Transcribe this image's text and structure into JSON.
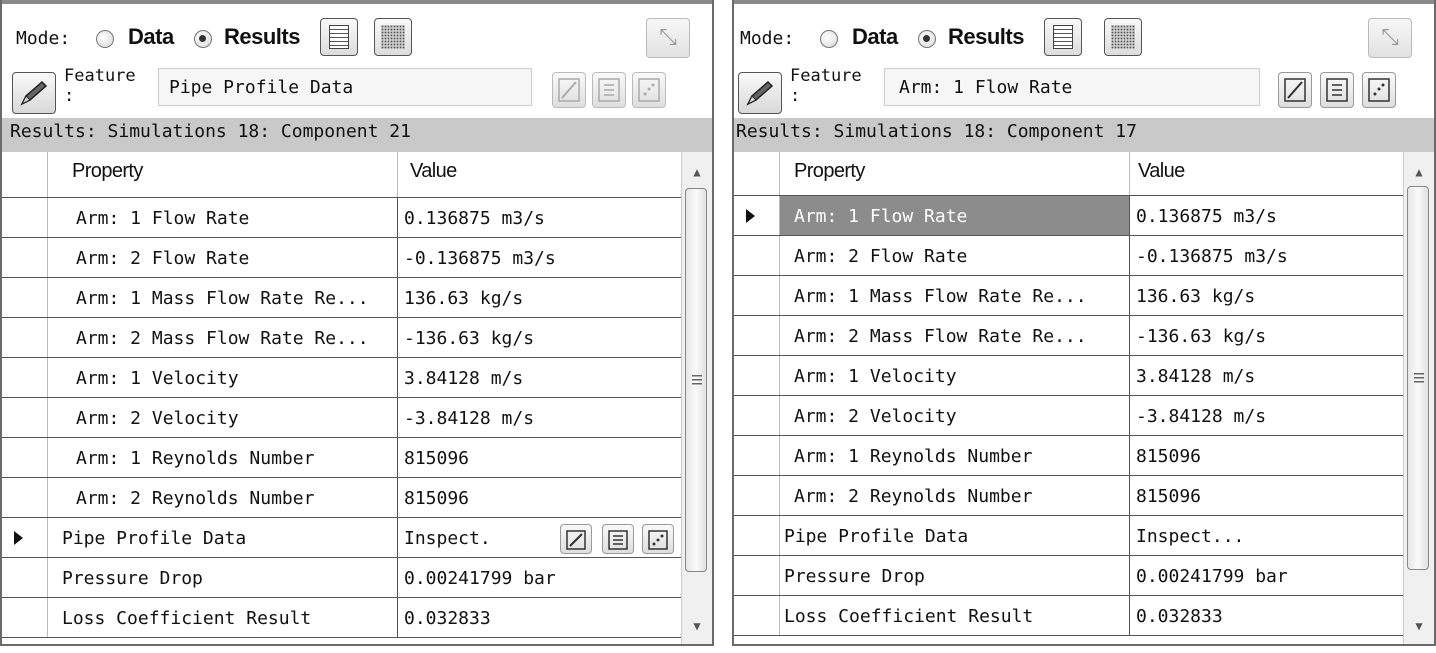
{
  "panels": [
    {
      "mode_label": "Mode:",
      "mode_options": [
        "Data",
        "Results"
      ],
      "mode_selected": "Results",
      "feature_label": "Feature",
      "feature_colon": ":",
      "feature_value": "Pipe Profile Data",
      "results_bar": "Results: Simulations 18: Component 21",
      "columns": [
        "Property",
        "Value"
      ],
      "selected_row": 8,
      "rows": [
        {
          "property": "Arm: 1 Flow Rate",
          "value": "0.136875 m3/s"
        },
        {
          "property": "Arm: 2 Flow Rate",
          "value": "-0.136875 m3/s"
        },
        {
          "property": "Arm: 1 Mass Flow Rate Re...",
          "value": "136.63 kg/s"
        },
        {
          "property": "Arm: 2 Mass Flow Rate Re...",
          "value": "-136.63 kg/s"
        },
        {
          "property": "Arm: 1 Velocity",
          "value": "3.84128 m/s"
        },
        {
          "property": "Arm: 2 Velocity",
          "value": "-3.84128 m/s"
        },
        {
          "property": "Arm: 1 Reynolds Number",
          "value": "815096"
        },
        {
          "property": "Arm: 2 Reynolds Number",
          "value": "815096"
        },
        {
          "property": "Pipe Profile Data",
          "value": "Inspect."
        },
        {
          "property": "Pressure Drop",
          "value": "0.00241799 bar"
        },
        {
          "property": "Loss Coefficient Result",
          "value": "0.032833"
        }
      ]
    },
    {
      "mode_label": "Mode:",
      "mode_options": [
        "Data",
        "Results"
      ],
      "mode_selected": "Results",
      "feature_label": "Feature",
      "feature_colon": ":",
      "feature_value": "Arm: 1 Flow Rate",
      "results_bar": "Results: Simulations 18: Component 17",
      "columns": [
        "Property",
        "Value"
      ],
      "selected_row": 0,
      "rows": [
        {
          "property": "Arm: 1 Flow Rate",
          "value": "0.136875 m3/s"
        },
        {
          "property": "Arm: 2 Flow Rate",
          "value": "-0.136875 m3/s"
        },
        {
          "property": "Arm: 1 Mass Flow Rate Re...",
          "value": "136.63 kg/s"
        },
        {
          "property": "Arm: 2 Mass Flow Rate Re...",
          "value": "-136.63 kg/s"
        },
        {
          "property": "Arm: 1 Velocity",
          "value": "3.84128 m/s"
        },
        {
          "property": "Arm: 2 Velocity",
          "value": "-3.84128 m/s"
        },
        {
          "property": "Arm: 1 Reynolds Number",
          "value": "815096"
        },
        {
          "property": "Arm: 2 Reynolds Number",
          "value": "815096"
        },
        {
          "property": "Pipe Profile Data",
          "value": "Inspect..."
        },
        {
          "property": "Pressure Drop",
          "value": "0.00241799 bar"
        },
        {
          "property": "Loss Coefficient Result",
          "value": "0.032833"
        }
      ]
    }
  ],
  "icons": [
    "pencil-icon",
    "list-icon",
    "dots-icon",
    "corner-icon",
    "line-chart-icon",
    "list-view-icon",
    "scatter-icon",
    "scroll-up-icon",
    "scroll-down-icon"
  ]
}
